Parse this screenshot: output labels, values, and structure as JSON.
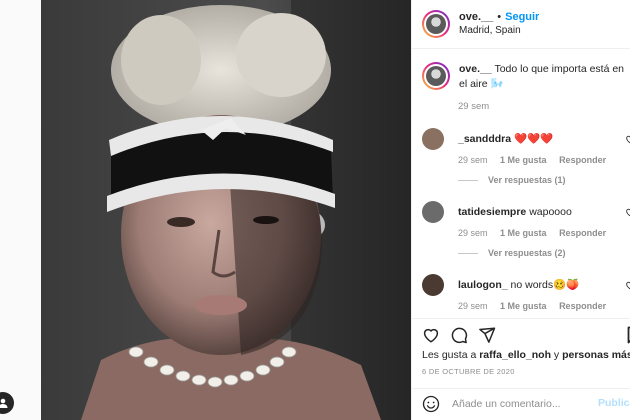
{
  "post": {
    "username": "ove.__",
    "separator": "•",
    "follow_label": "Seguir",
    "location": "Madrid, Spain",
    "caption": {
      "username": "ove.__",
      "text": "Todo lo que importa está en el aire 🌬️",
      "time": "29 sem"
    },
    "comments": [
      {
        "username": "_sandddra",
        "text": "❤️❤️❤️",
        "time": "29 sem",
        "likes": "1 Me gusta",
        "reply_label": "Responder",
        "replies": "Ver respuestas (1)",
        "avatar_color": "#8a7060"
      },
      {
        "username": "tatidesiempre",
        "text": "wapoooo",
        "time": "29 sem",
        "likes": "1 Me gusta",
        "reply_label": "Responder",
        "replies": "Ver respuestas (2)",
        "avatar_color": "#6b6b6b"
      },
      {
        "username": "laulogon_",
        "text": "no words🥴🍑",
        "time": "29 sem",
        "likes": "1 Me gusta",
        "reply_label": "Responder",
        "replies": "",
        "avatar_color": "#4a3a32"
      }
    ],
    "likes_prefix": "Les gusta a",
    "likes_user": "raffa_ello_noh",
    "likes_conj": "y",
    "likes_others": "personas más",
    "date": "6 DE OCTUBRE DE 2020",
    "add_comment_placeholder": "Añade un comentario...",
    "publish_label": "Publica"
  },
  "icons": {
    "like": "heart-icon",
    "comment": "comment-icon",
    "share": "share-icon",
    "save": "bookmark-icon",
    "emoji": "emoji-icon",
    "comment_like": "small-heart-icon"
  },
  "colors": {
    "accent": "#0095f6",
    "publish_disabled": "#b2dffc",
    "muted": "#8e8e8e",
    "text": "#262626"
  }
}
